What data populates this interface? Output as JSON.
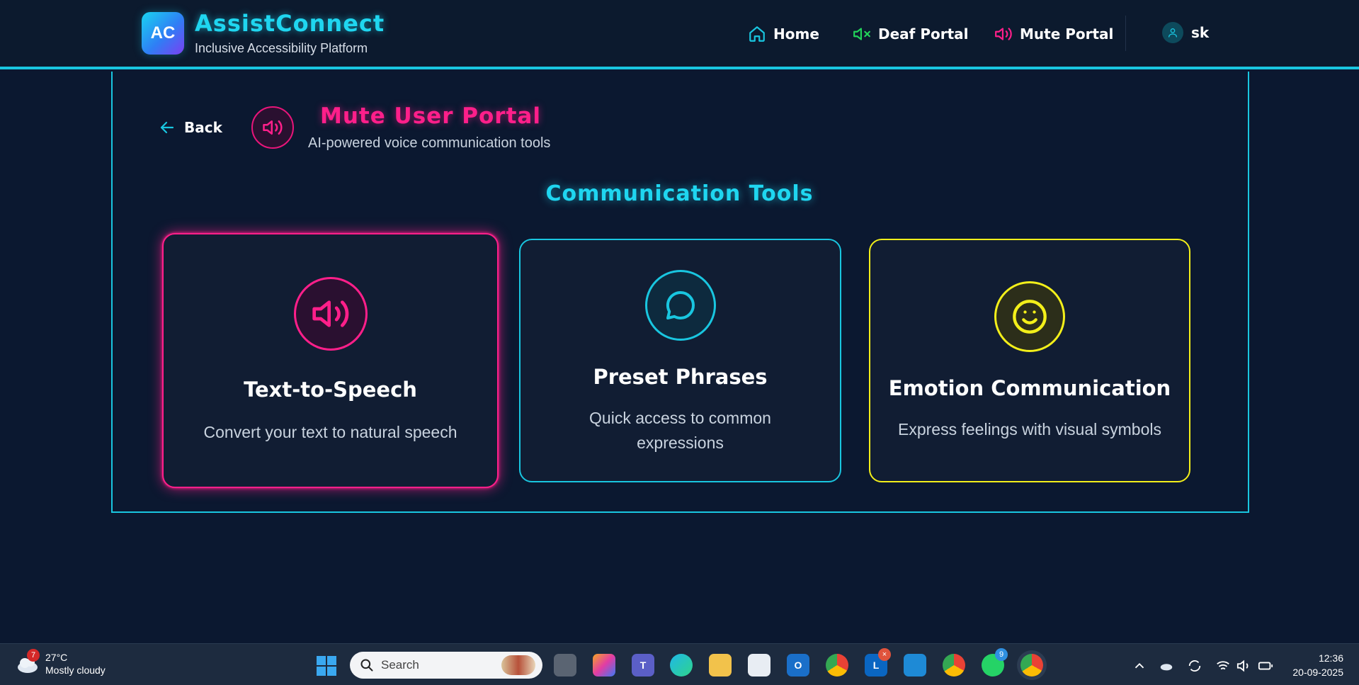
{
  "header": {
    "logo_initials": "AC",
    "app_name": "AssistConnect",
    "tagline": "Inclusive Accessibility Platform",
    "nav": [
      {
        "label": "Home",
        "icon": "home-icon"
      },
      {
        "label": "Deaf Portal",
        "icon": "speaker-mute-icon"
      },
      {
        "label": "Mute Portal",
        "icon": "speaker-wave-icon"
      }
    ],
    "user": {
      "name": "sk",
      "icon": "user-icon"
    }
  },
  "portal": {
    "back_label": "Back",
    "title": "Mute User Portal",
    "subtitle": "AI-powered voice communication tools",
    "icon": "speaker-wave-icon"
  },
  "tools": {
    "section_title": "Communication Tools",
    "cards": [
      {
        "title": "Text-to-Speech",
        "description": "Convert your text to natural speech",
        "icon": "speaker-wave-icon",
        "accent": "#ff1f8a"
      },
      {
        "title": "Preset Phrases",
        "description_line1": "Quick access to common",
        "description_line2": "expressions",
        "icon": "chat-bubble-icon",
        "accent": "#19c6e0"
      },
      {
        "title": "Emotion Communication",
        "description": "Express feelings with visual symbols",
        "icon": "smiley-icon",
        "accent": "#f3ef1a"
      }
    ]
  },
  "taskbar": {
    "weather": {
      "temp": "27°C",
      "condition": "Mostly cloudy",
      "badge": "7"
    },
    "search_placeholder": "Search",
    "whatsapp_badge": "9",
    "clock": {
      "time": "12:36",
      "date": "20-09-2025"
    }
  },
  "colors": {
    "cyan": "#19c6e0",
    "pink": "#ff1f8a",
    "yellow": "#f3ef1a",
    "green": "#22d35a",
    "background": "#0b1830"
  }
}
